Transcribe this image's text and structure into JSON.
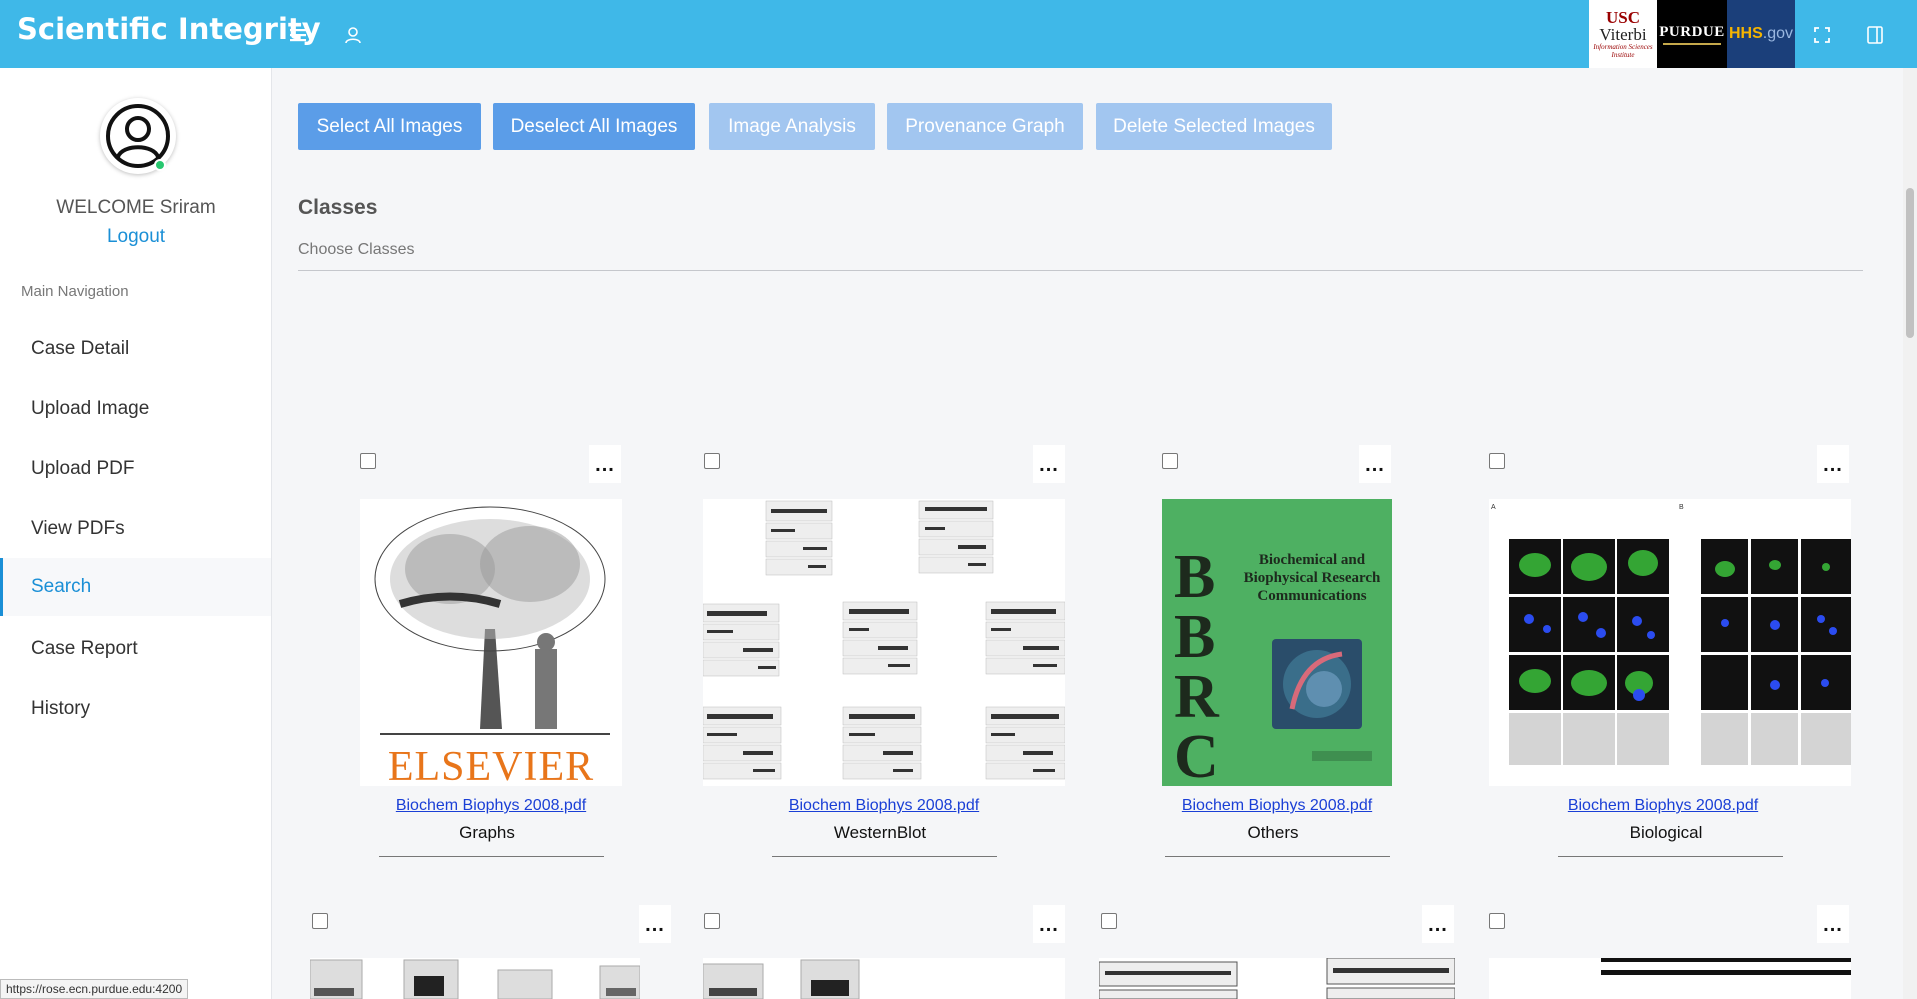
{
  "app": {
    "title": "Scientific Integrity"
  },
  "header": {
    "icons": [
      "menu-icon",
      "user-icon",
      "fullscreen-icon",
      "panel-toggle-icon"
    ],
    "logos": {
      "usc_line1": "USC",
      "usc_line2": "Viterbi",
      "usc_line3": "Information Sciences Institute",
      "purdue": "PURDUE",
      "hhs_main": "HHS",
      "hhs_suffix": ".gov"
    }
  },
  "sidebar": {
    "welcome": "WELCOME Sriram",
    "logout": "Logout",
    "heading": "Main Navigation",
    "items": [
      {
        "label": "Case Detail"
      },
      {
        "label": "Upload Image"
      },
      {
        "label": "Upload PDF"
      },
      {
        "label": "View PDFs"
      },
      {
        "label": "Search",
        "active": true
      },
      {
        "label": "Case Report"
      },
      {
        "label": "History"
      }
    ]
  },
  "toolbar": {
    "select_all": "Select All Images",
    "deselect_all": "Deselect All Images",
    "image_analysis": "Image Analysis",
    "provenance_graph": "Provenance Graph",
    "delete_selected": "Delete Selected Images"
  },
  "classes": {
    "title": "Classes",
    "placeholder": "Choose Classes"
  },
  "cards": [
    {
      "file": "Biochem Biophys 2008.pdf",
      "class": "Graphs",
      "menu": "...",
      "cover": "ELSEVIER"
    },
    {
      "file": "Biochem Biophys 2008.pdf",
      "class": "WesternBlot",
      "menu": "..."
    },
    {
      "file": "Biochem Biophys 2008.pdf",
      "class": "Others",
      "menu": "...",
      "cover_big": "BBRC",
      "cover_title": "Biochemical and Biophysical Research Communications"
    },
    {
      "file": "Biochem Biophys 2008.pdf",
      "class": "Biological",
      "menu": "..."
    }
  ],
  "row2_menus": [
    "...",
    "...",
    "...",
    "..."
  ],
  "status_url": "https://rose.ecn.purdue.edu:4200"
}
